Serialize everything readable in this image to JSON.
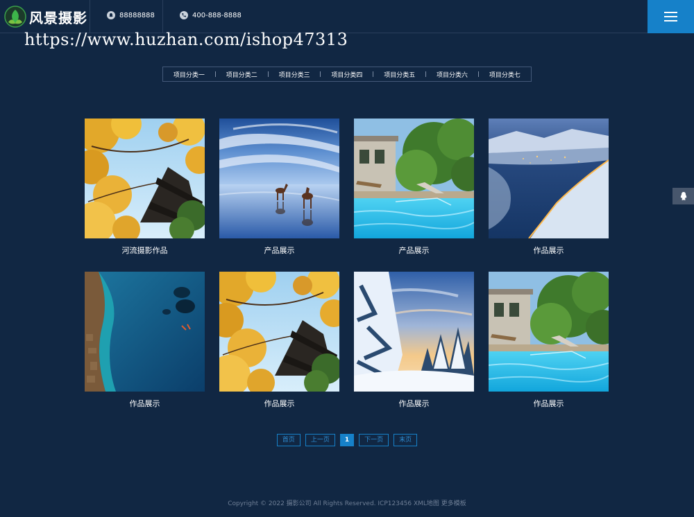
{
  "header": {
    "logo_text": "风景摄影",
    "phone1": "88888888",
    "phone2": "400-888-8888"
  },
  "watermark": "https://www.huzhan.com/ishop47313",
  "categories": [
    "项目分类一",
    "项目分类二",
    "项目分类三",
    "项目分类四",
    "项目分类五",
    "项目分类六",
    "项目分类七"
  ],
  "items": [
    {
      "caption": "河流摄影作品",
      "image": "ginkgo-temple"
    },
    {
      "caption": "产品展示",
      "image": "horses-reflection"
    },
    {
      "caption": "产品展示",
      "image": "pool-villa"
    },
    {
      "caption": "作品展示",
      "image": "night-fjord"
    },
    {
      "caption": "作品展示",
      "image": "ocean-shore"
    },
    {
      "caption": "作品展示",
      "image": "ginkgo-temple"
    },
    {
      "caption": "作品展示",
      "image": "snowy-forest"
    },
    {
      "caption": "作品展示",
      "image": "pool-villa"
    }
  ],
  "pagination": {
    "first": "首页",
    "prev": "上一页",
    "current": "1",
    "next": "下一页",
    "last": "末页"
  },
  "footer": "Copyright © 2022 摄影公司 All Rights Reserved. ICP123456 XML地图 更多模板",
  "colors": {
    "background": "#112743",
    "accent": "#1681c9"
  }
}
